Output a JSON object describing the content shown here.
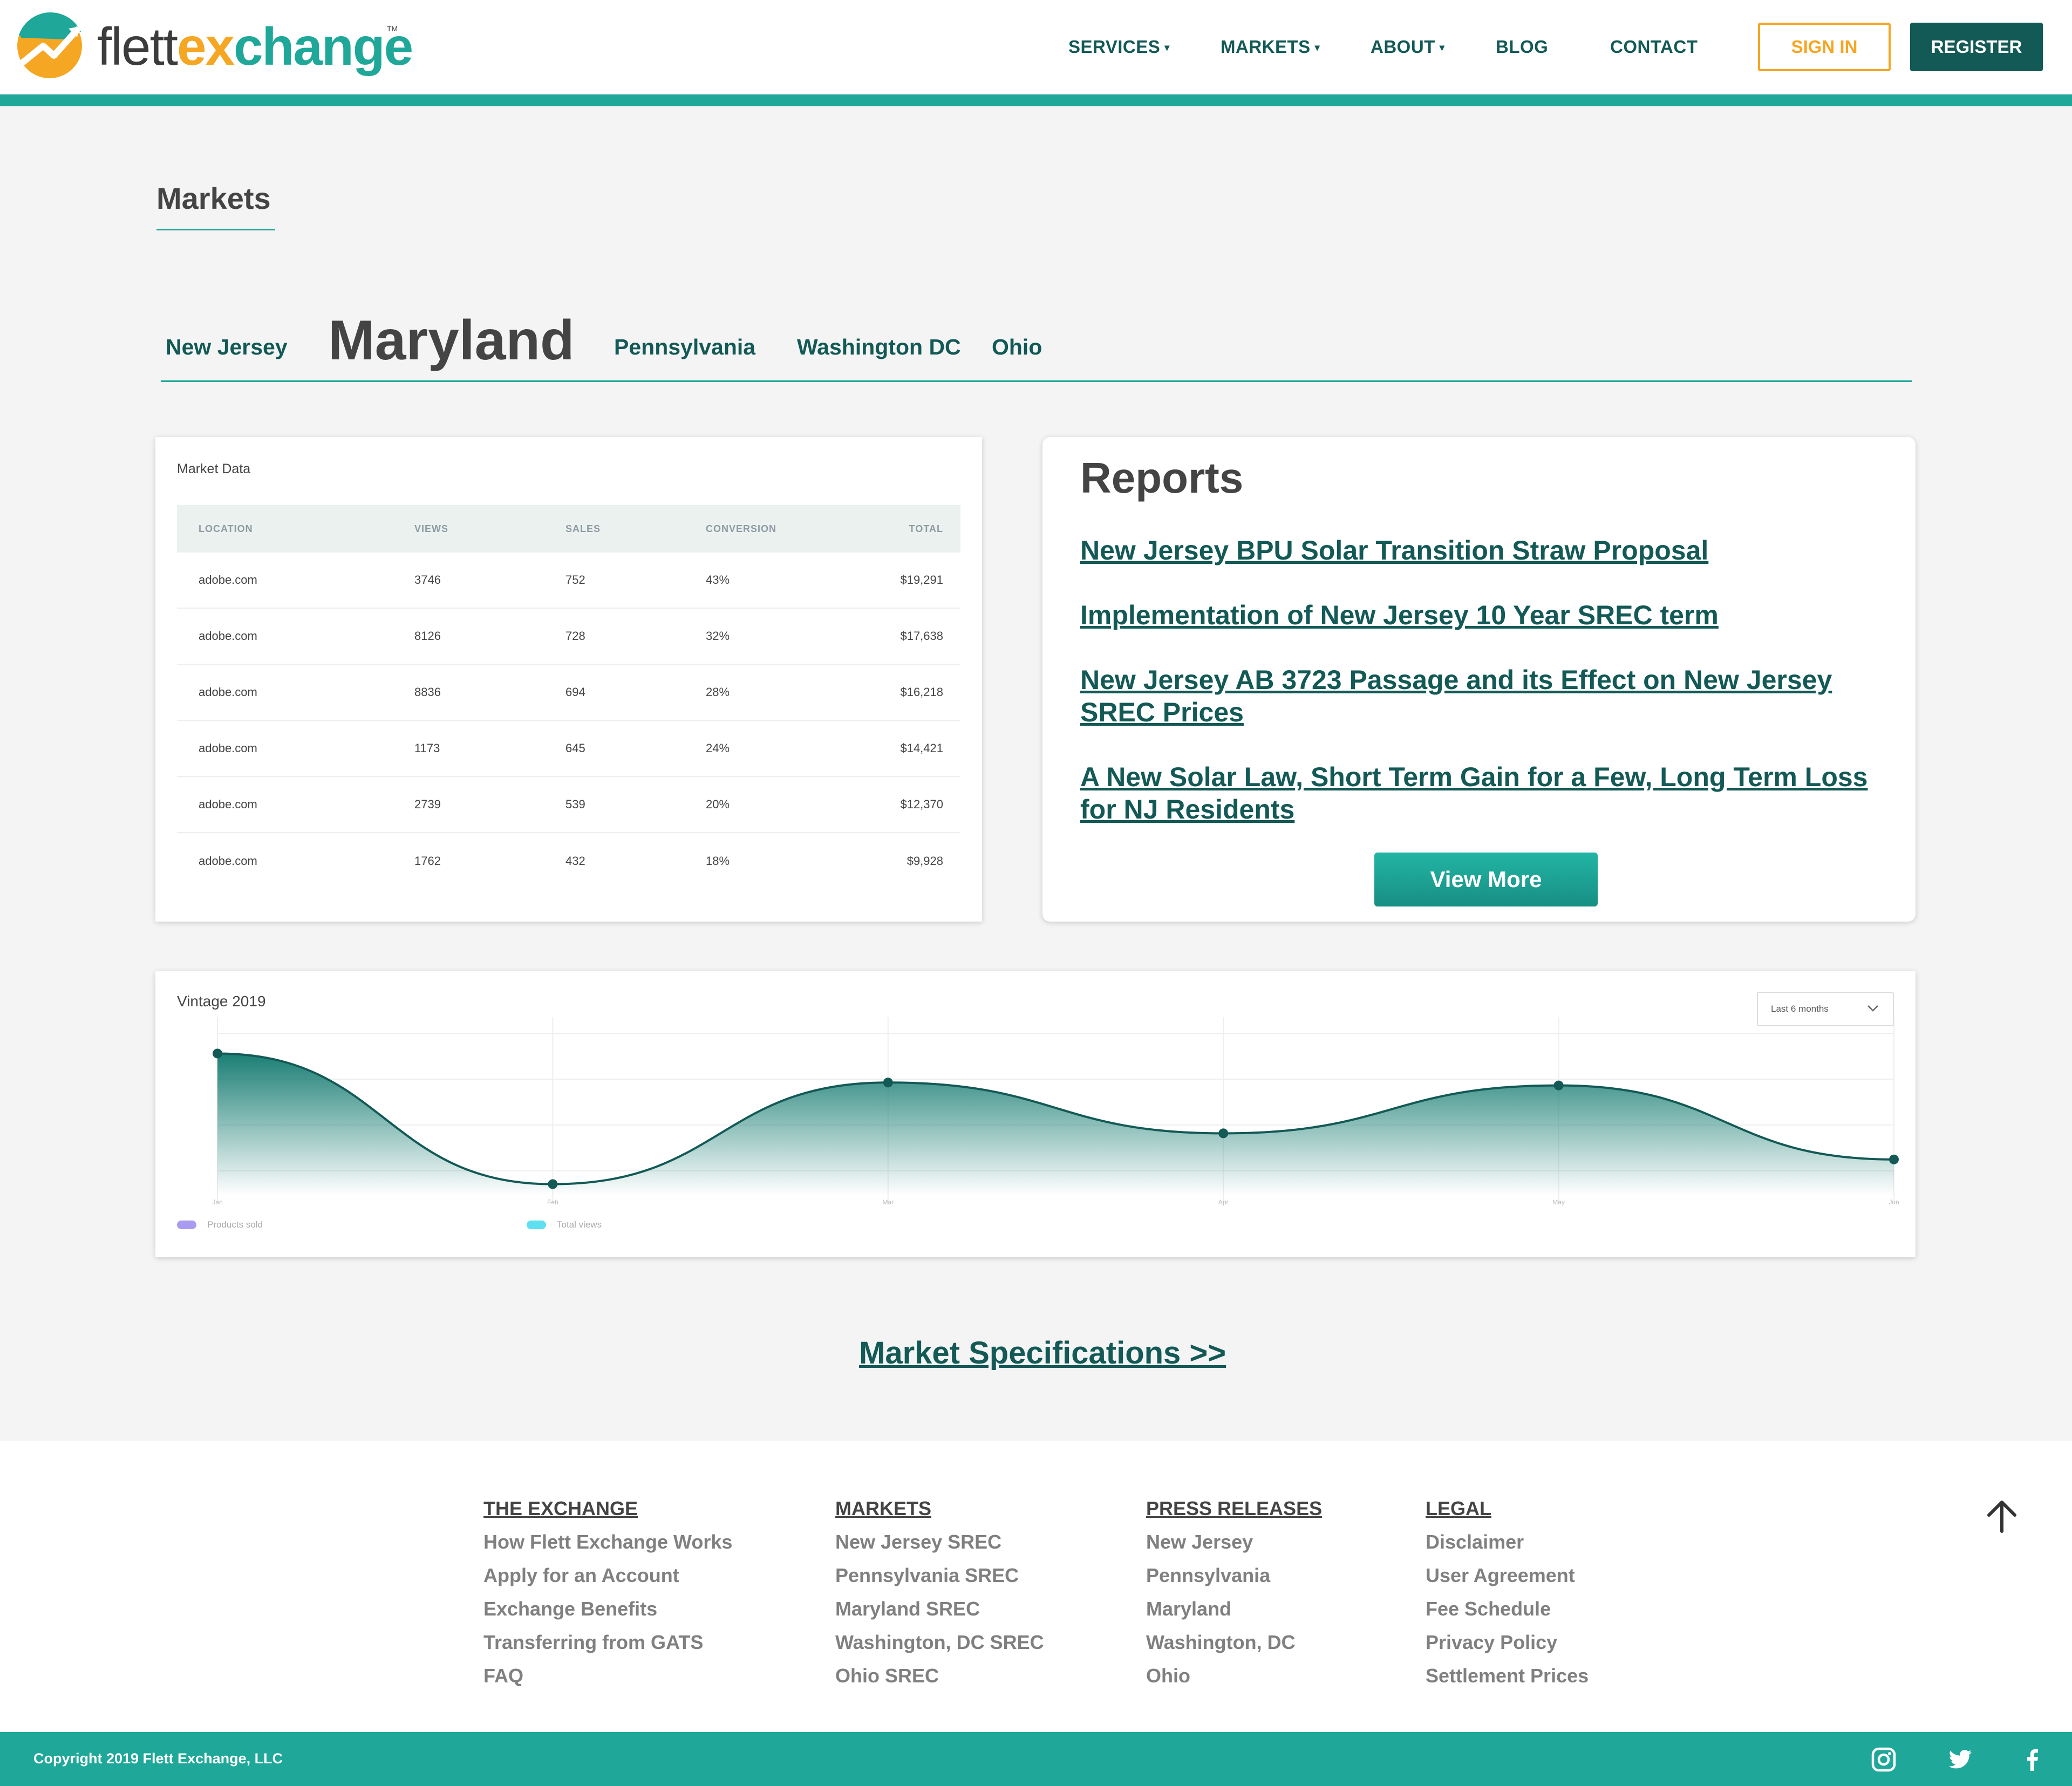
{
  "brand": {
    "logo_part1": "flett",
    "logo_part2": "ex",
    "logo_part3": "change",
    "trademark": "TM"
  },
  "nav": {
    "services": "SERVICES",
    "markets": "MARKETS",
    "about": "ABOUT",
    "blog": "BLOG",
    "contact": "CONTACT",
    "caret": "▾",
    "sign_in": "SIGN IN",
    "register": "REGISTER"
  },
  "page_title": "Markets",
  "tabs": [
    "New Jersey",
    "Maryland",
    "Pennsylvania",
    "Washington DC",
    "Ohio"
  ],
  "market_data": {
    "title": "Market Data",
    "columns": [
      "LOCATION",
      "VIEWS",
      "SALES",
      "CONVERSION",
      "TOTAL"
    ],
    "rows": [
      [
        "adobe.com",
        "3746",
        "752",
        "43%",
        "$19,291"
      ],
      [
        "adobe.com",
        "8126",
        "728",
        "32%",
        "$17,638"
      ],
      [
        "adobe.com",
        "8836",
        "694",
        "28%",
        "$16,218"
      ],
      [
        "adobe.com",
        "1173",
        "645",
        "24%",
        "$14,421"
      ],
      [
        "adobe.com",
        "2739",
        "539",
        "20%",
        "$12,370"
      ],
      [
        "adobe.com",
        "1762",
        "432",
        "18%",
        "$9,928"
      ]
    ]
  },
  "reports": {
    "title": "Reports",
    "links": [
      "New Jersey BPU Solar Transition Straw Proposal",
      "Implementation of New Jersey 10 Year SREC term",
      "New Jersey AB 3723 Passage and its Effect on New Jersey SREC Prices",
      "A New Solar Law, Short Term Gain for a Few, Long Term Loss for NJ Residents"
    ],
    "view_more": "View More"
  },
  "vintage_chart": {
    "title": "Vintage 2019",
    "select_value": "Last 6 months",
    "legend": [
      "Products sold",
      "Total views"
    ],
    "colors": {
      "line": "#135956",
      "fill": "#1a7e74",
      "legend_products": "#a99cf0",
      "legend_views": "#5ee0f0"
    }
  },
  "chart_data": {
    "type": "area",
    "categories": [
      "Jan",
      "Feb",
      "Mar",
      "Apr",
      "May",
      "Jun"
    ],
    "series": [
      {
        "values": [
          0.95,
          0.05,
          0.75,
          0.4,
          0.73,
          0.22
        ]
      }
    ],
    "y_ticks": [
      "",
      "",
      "",
      ""
    ],
    "grid": true
  },
  "market_specs_link": "Market Specifications >>",
  "footer": {
    "columns": [
      {
        "heading": "THE EXCHANGE",
        "links": [
          "How Flett Exchange Works",
          "Apply for an Account",
          "Exchange Benefits",
          "Transferring from GATS",
          "FAQ"
        ]
      },
      {
        "heading": "MARKETS",
        "links": [
          "New Jersey SREC",
          "Pennsylvania SREC",
          "Maryland SREC",
          "Washington, DC SREC",
          "Ohio SREC"
        ]
      },
      {
        "heading": "PRESS RELEASES",
        "links": [
          "New Jersey",
          "Pennsylvania",
          "Maryland",
          "Washington, DC",
          "Ohio"
        ]
      },
      {
        "heading": "LEGAL",
        "links": [
          "Disclaimer",
          "User Agreement",
          "Fee Schedule",
          "Privacy Policy",
          "Settlement Prices"
        ]
      }
    ],
    "copyright": "Copyright 2019 Flett Exchange, LLC"
  },
  "icons": {
    "to_top": "arrow-up-icon",
    "instagram": "instagram-icon",
    "twitter": "twitter-icon",
    "facebook": "facebook-icon"
  },
  "colors": {
    "brand_teal": "#1fa899",
    "brand_dark": "#135956",
    "brand_orange": "#f5a623"
  }
}
